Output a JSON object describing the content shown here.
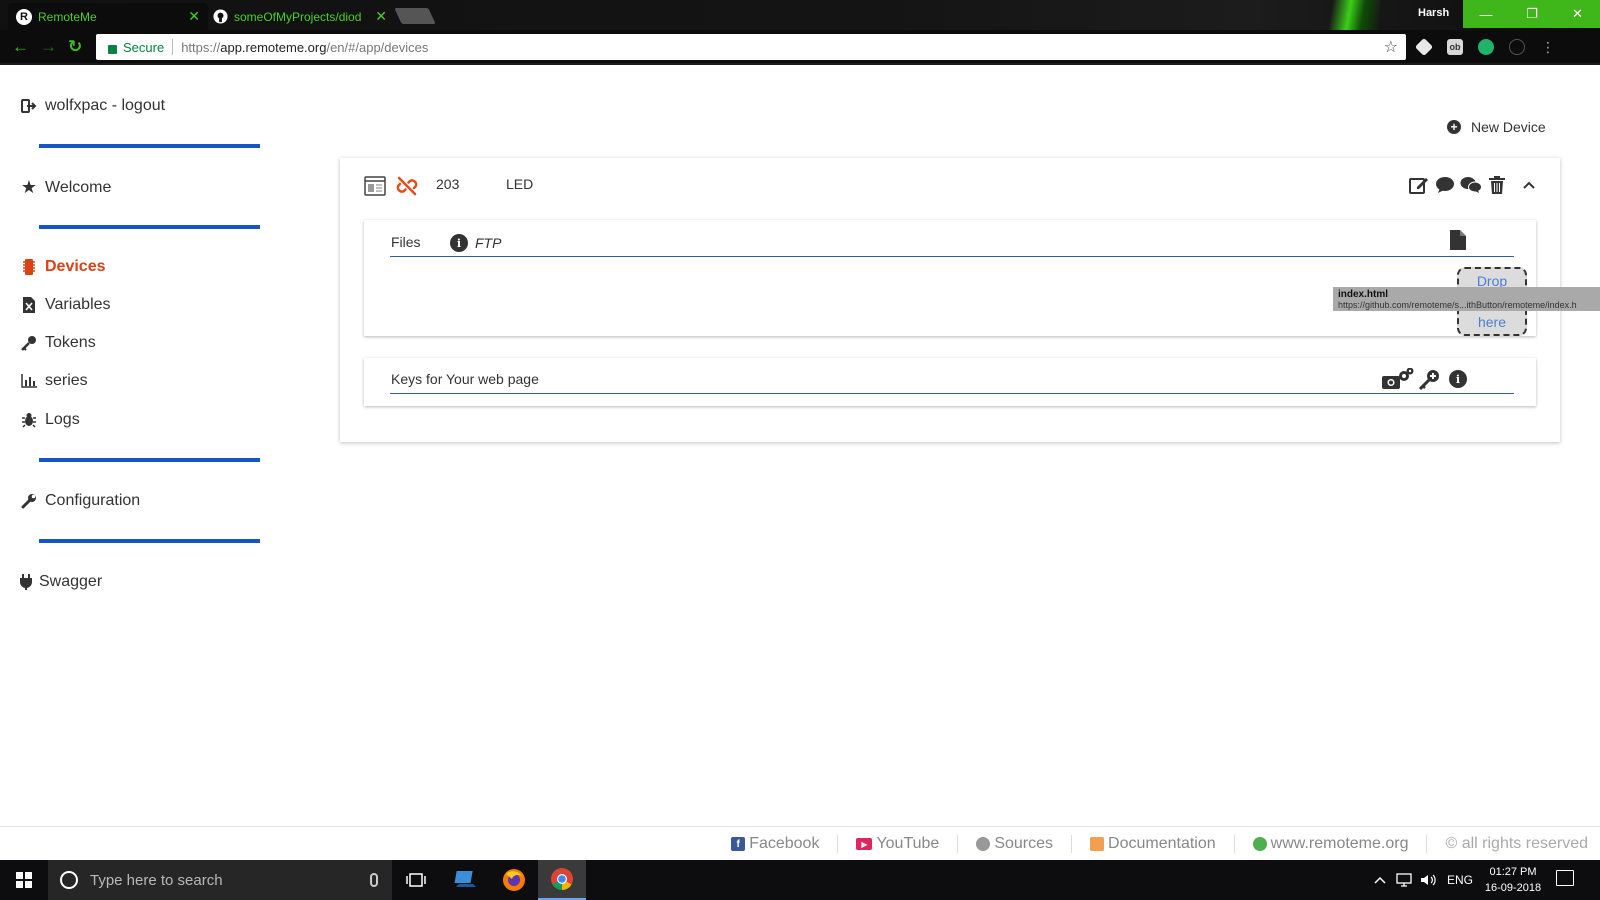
{
  "browser": {
    "tabs": [
      {
        "label": "RemoteMe",
        "favicon": "R",
        "active": true
      },
      {
        "label": "someOfMyProjects/diod",
        "active": false
      }
    ],
    "profile": "Harsh",
    "window_controls": {
      "minimize": "—",
      "maximize": "❐",
      "close": "✕"
    },
    "address": {
      "secure_label": "Secure",
      "url_prefix": "https://",
      "url_host": "app.remoteme.org",
      "url_path": "/en/#/app/devices"
    }
  },
  "sidebar": {
    "user": {
      "label": "wolfxpac - logout",
      "icon": "sign-out-icon"
    },
    "welcome": {
      "label": "Welcome",
      "icon": "star-icon"
    },
    "devices": {
      "label": "Devices",
      "icon": "microchip-icon",
      "active": true
    },
    "variables": {
      "label": "Variables",
      "icon": "file-excel-icon"
    },
    "tokens": {
      "label": "Tokens",
      "icon": "key-icon"
    },
    "series": {
      "label": "series",
      "icon": "bar-chart-icon"
    },
    "logs": {
      "label": "Logs",
      "icon": "bug-icon"
    },
    "configuration": {
      "label": "Configuration",
      "icon": "wrench-icon"
    },
    "swagger": {
      "label": "Swagger",
      "icon": "plug-icon"
    },
    "accent_color": "#d84315",
    "divider_color": "#1456c8"
  },
  "main": {
    "new_device_label": "New Device",
    "device": {
      "id": "203",
      "name": "LED",
      "files": {
        "title": "Files",
        "ftp_label": "FTP",
        "drop_top": "Drop",
        "drop_bottom": "here"
      },
      "keys": {
        "title": "Keys for Your web page"
      }
    },
    "tooltip": {
      "title": "index.html",
      "url": "https://github.com/remoteme/s...ithButton/remoteme/index.h"
    }
  },
  "footer": {
    "links": [
      {
        "label": "Facebook",
        "icon": "facebook-icon",
        "color": "#3b5998"
      },
      {
        "label": "YouTube",
        "icon": "youtube-icon",
        "color": "#e0245e"
      },
      {
        "label": "Sources",
        "icon": "github-icon",
        "color": "#999999"
      },
      {
        "label": "Documentation",
        "icon": "book-icon",
        "color": "#f0a050"
      },
      {
        "label": "www.remoteme.org",
        "icon": "globe-icon",
        "color": "#4caf50"
      }
    ],
    "copyright": "© all rights reserved"
  },
  "taskbar": {
    "search_placeholder": "Type here to search",
    "language": "ENG",
    "time": "01:27 PM",
    "date": "16-09-2018"
  }
}
